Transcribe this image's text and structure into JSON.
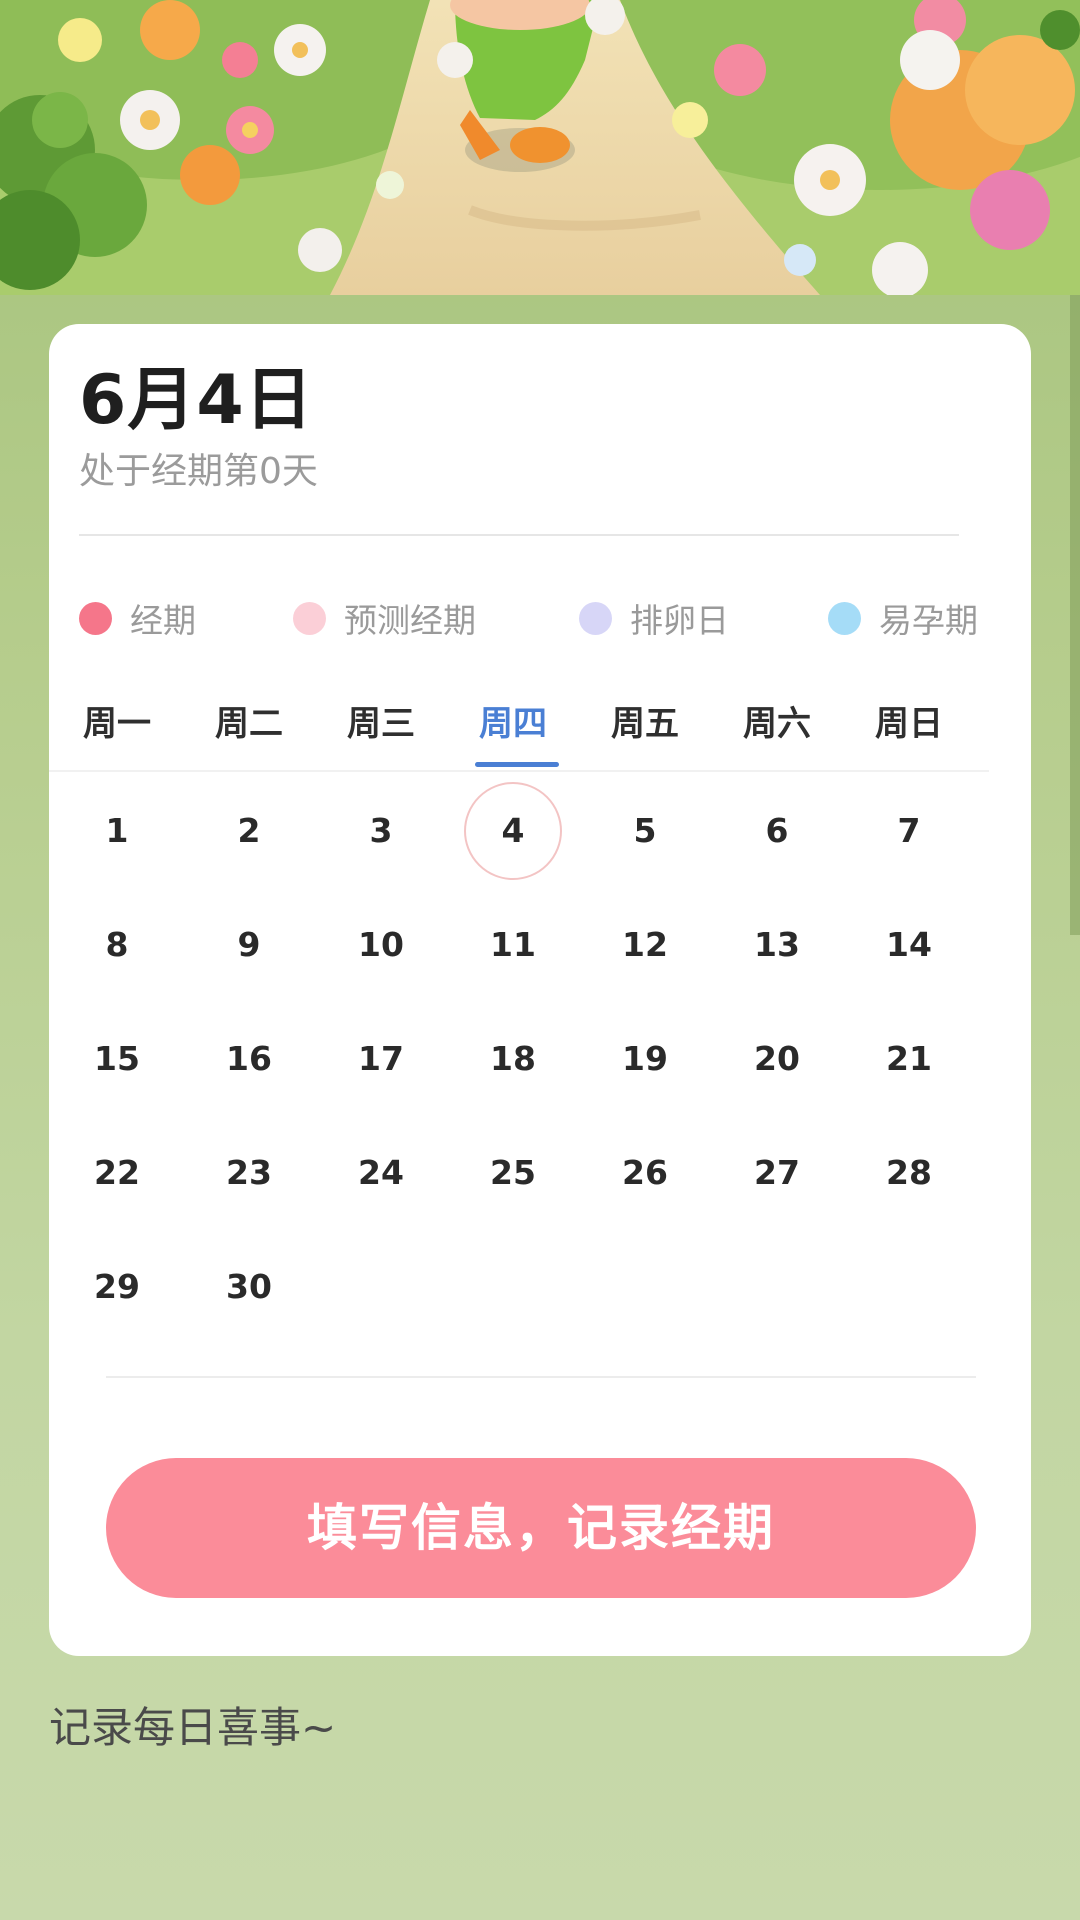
{
  "header": {
    "date_title": "6月4日",
    "cycle_status": "处于经期第0天"
  },
  "legend": [
    {
      "label": "经期",
      "color": "#f5768a"
    },
    {
      "label": "预测经期",
      "color": "#fbcfd7"
    },
    {
      "label": "排卵日",
      "color": "#d7d6f7"
    },
    {
      "label": "易孕期",
      "color": "#a5dcf7"
    }
  ],
  "weekdays": {
    "items": [
      "周一",
      "周二",
      "周三",
      "周四",
      "周五",
      "周六",
      "周日"
    ],
    "active_index": 3
  },
  "calendar": {
    "days": [
      "1",
      "2",
      "3",
      "4",
      "5",
      "6",
      "7",
      "8",
      "9",
      "10",
      "11",
      "12",
      "13",
      "14",
      "15",
      "16",
      "17",
      "18",
      "19",
      "20",
      "21",
      "22",
      "23",
      "24",
      "25",
      "26",
      "27",
      "28",
      "29",
      "30"
    ],
    "first_weekday_index": 0,
    "selected_day": "4"
  },
  "actions": {
    "record_label": "填写信息，记录经期"
  },
  "daily": {
    "section_title": "记录每日喜事~"
  },
  "colors": {
    "accent_blue": "#4a7fd4",
    "button_pink": "#fb8c99",
    "ring_pink": "#f3c4c4"
  }
}
